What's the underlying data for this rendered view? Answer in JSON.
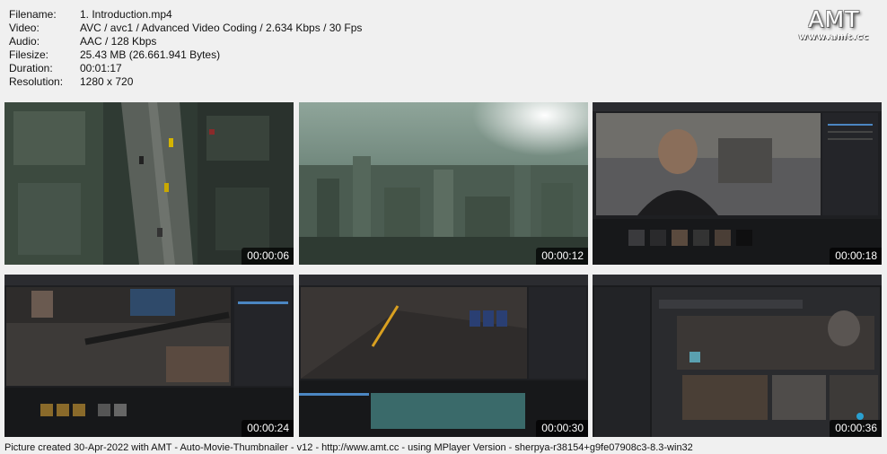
{
  "meta": {
    "rows": [
      {
        "key": "Filename:",
        "value": "1. Introduction.mp4"
      },
      {
        "key": "Video:",
        "value": "AVC / avc1 / Advanced Video Coding / 2.634 Kbps / 30 Fps"
      },
      {
        "key": "Audio:",
        "value": "AAC / 128 Kbps"
      },
      {
        "key": "Filesize:",
        "value": "25.43 MB (26.661.941 Bytes)"
      },
      {
        "key": "Duration:",
        "value": "00:01:17"
      },
      {
        "key": "Resolution:",
        "value": "1280 x 720"
      }
    ]
  },
  "logo": {
    "title": "AMT",
    "url": "www.amt.cc"
  },
  "thumbnails": [
    {
      "timestamp": "00:00:06",
      "scene": "aerial-city-street"
    },
    {
      "timestamp": "00:00:12",
      "scene": "city-skyline"
    },
    {
      "timestamp": "00:00:18",
      "scene": "editor-character"
    },
    {
      "timestamp": "00:00:24",
      "scene": "editor-street-props"
    },
    {
      "timestamp": "00:00:30",
      "scene": "editor-sequencer"
    },
    {
      "timestamp": "00:00:36",
      "scene": "asset-browser"
    }
  ],
  "footer": "Picture created 30-Apr-2022 with AMT - Auto-Movie-Thumbnailer - v12 - http://www.amt.cc - using MPlayer Version - sherpya-r38154+g9fe07908c3-8.3-win32"
}
